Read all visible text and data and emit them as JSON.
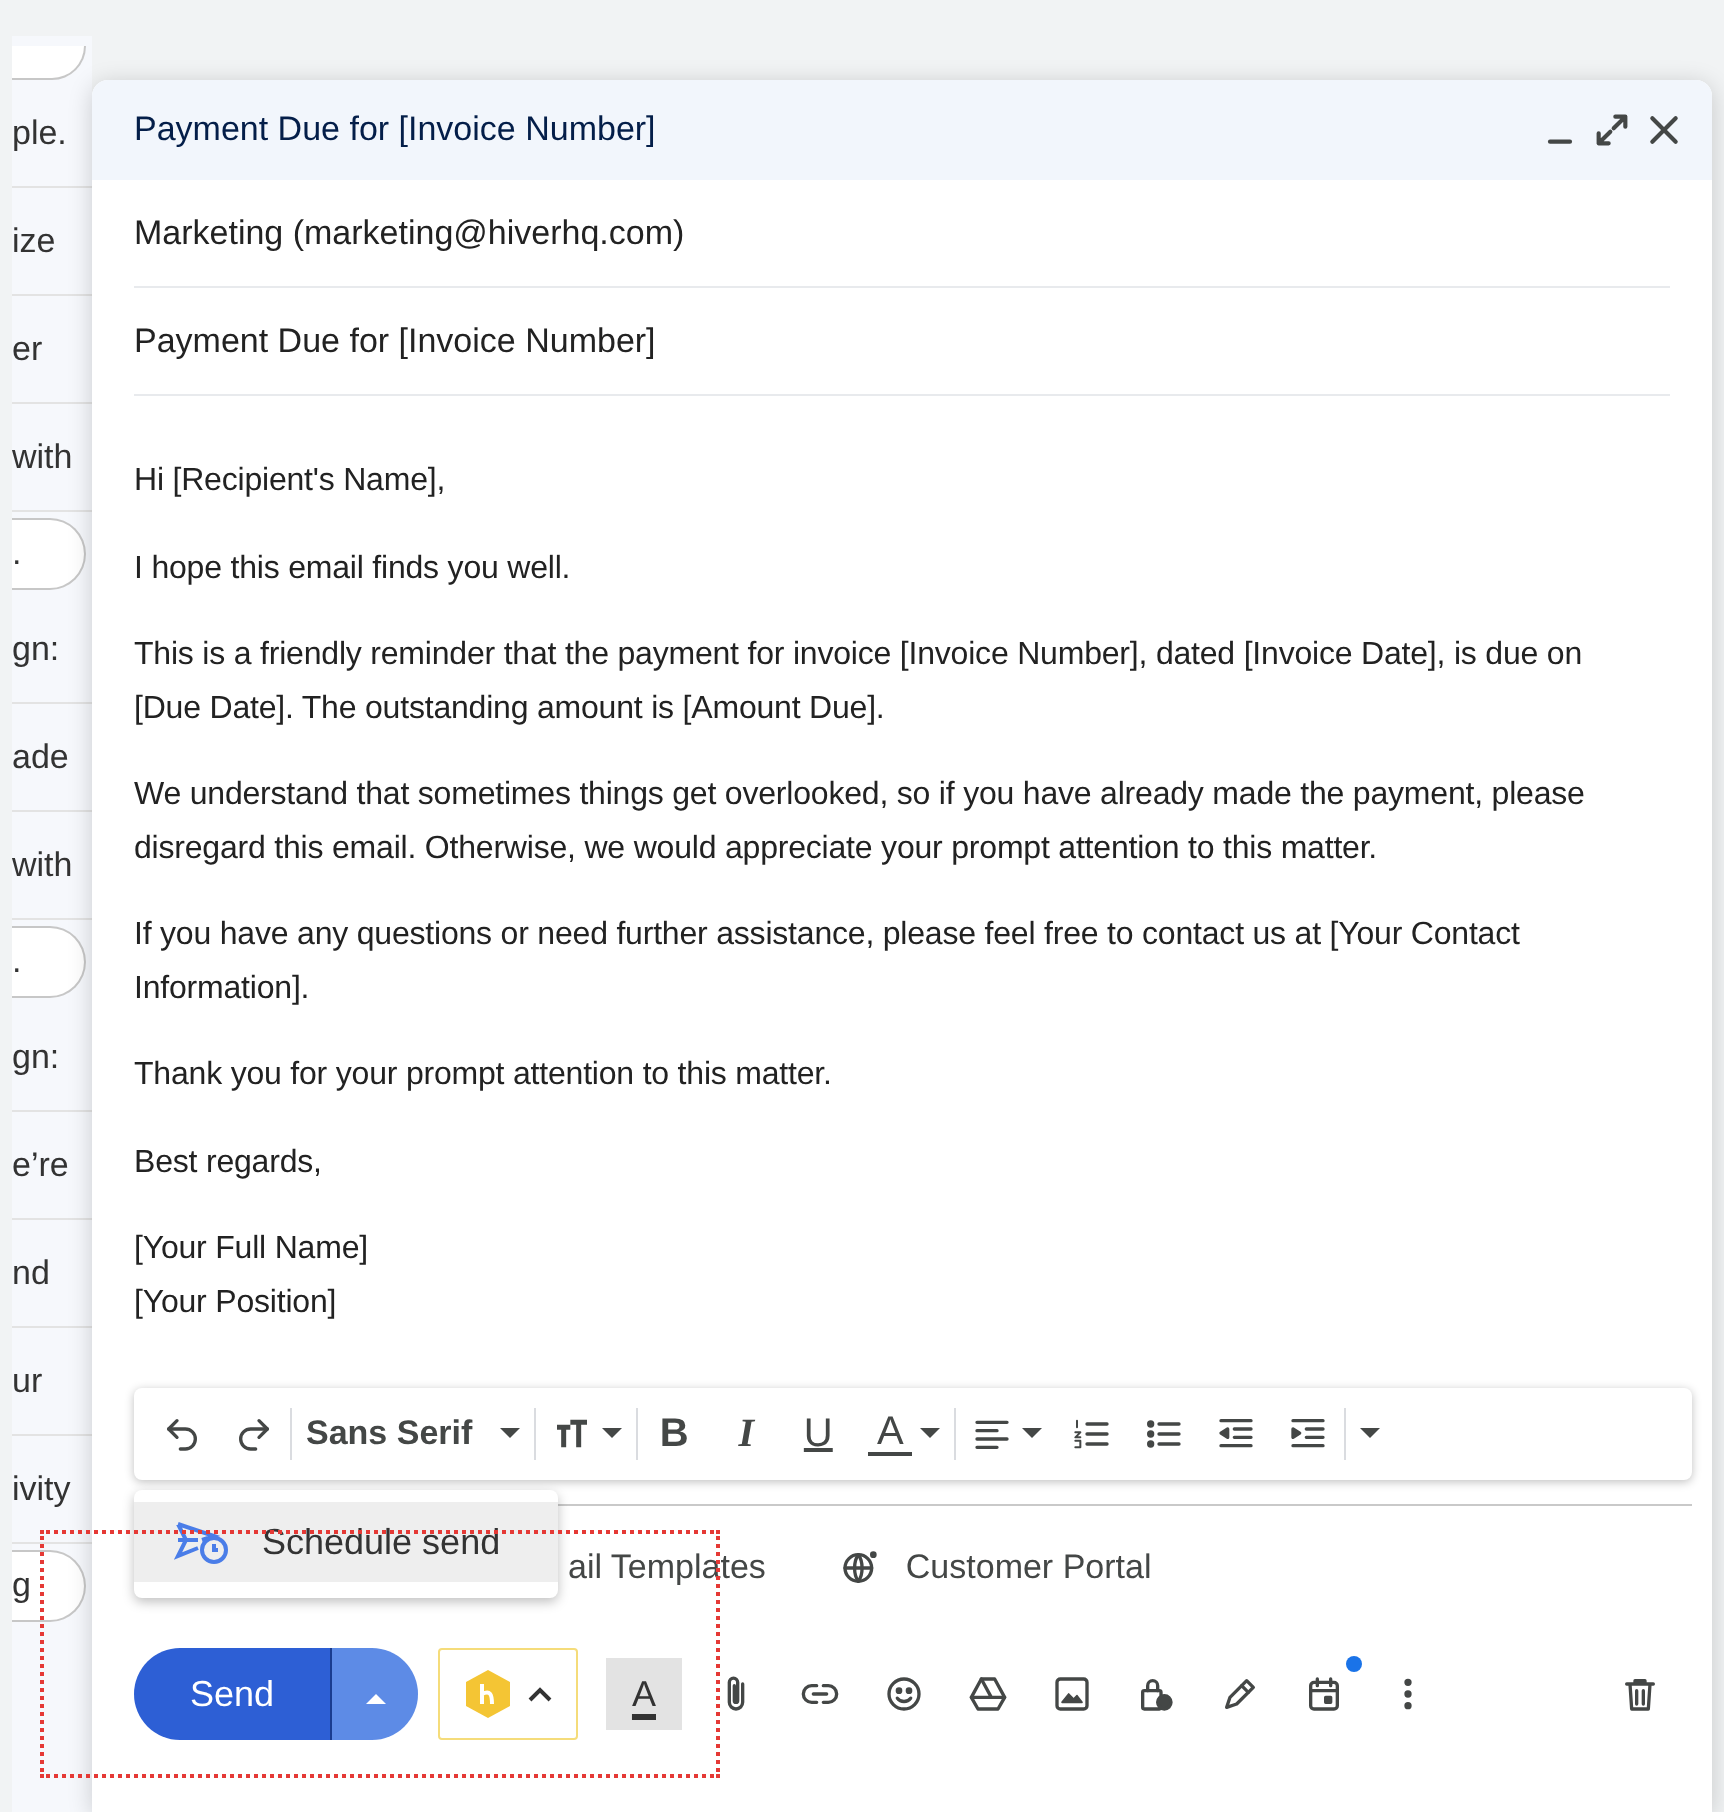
{
  "background_list": [
    {
      "kind": "pill"
    },
    {
      "kind": "text",
      "text": "ple."
    },
    {
      "kind": "text",
      "text": "ize"
    },
    {
      "kind": "text",
      "text": "er"
    },
    {
      "kind": "text",
      "text": "with"
    },
    {
      "kind": "pill",
      "text": "."
    },
    {
      "kind": "text",
      "text": "gn:"
    },
    {
      "kind": "text",
      "text": "ade"
    },
    {
      "kind": "text",
      "text": "with"
    },
    {
      "kind": "pill",
      "text": "."
    },
    {
      "kind": "text",
      "text": "gn:"
    },
    {
      "kind": "text",
      "text": "e’re"
    },
    {
      "kind": "text",
      "text": "nd"
    },
    {
      "kind": "text",
      "text": "ur"
    },
    {
      "kind": "text",
      "text": "ivity"
    },
    {
      "kind": "pill",
      "text": "g"
    }
  ],
  "compose": {
    "title": "Payment Due for [Invoice Number]",
    "window_controls": [
      {
        "kind": "minimize"
      },
      {
        "kind": "expand"
      },
      {
        "kind": "close"
      }
    ],
    "from": "Marketing (marketing@hiverhq.com)",
    "subject": "Payment Due for [Invoice Number]",
    "body": [
      "Hi [Recipient's Name],",
      "I hope this email finds you well.",
      "This is a friendly reminder that the payment for invoice [Invoice Number], dated [Invoice Date], is due on [Due Date]. The outstanding amount is [Amount Due].",
      "We understand that sometimes things get overlooked, so if you have already made the payment, please disregard this email. Otherwise, we would appreciate your prompt attention to this matter.",
      "If you have any questions or need further assistance, please feel free to contact us at [Your Contact Information].",
      "Thank you for your prompt attention to this matter.",
      "Best regards,",
      "[Your Full Name]\n[Your Position]"
    ],
    "format_toolbar": [
      {
        "kind": "undo"
      },
      {
        "kind": "redo"
      },
      {
        "kind": "sep"
      },
      {
        "kind": "font",
        "label": "Sans Serif"
      },
      {
        "kind": "sep"
      },
      {
        "kind": "size"
      },
      {
        "kind": "sep"
      },
      {
        "kind": "bold",
        "label": "B"
      },
      {
        "kind": "italic",
        "label": "I"
      },
      {
        "kind": "underline",
        "label": "U"
      },
      {
        "kind": "color",
        "label": "A"
      },
      {
        "kind": "sep"
      },
      {
        "kind": "align"
      },
      {
        "kind": "numbered"
      },
      {
        "kind": "bulleted"
      },
      {
        "kind": "outdent"
      },
      {
        "kind": "indent"
      },
      {
        "kind": "sep"
      },
      {
        "kind": "more"
      }
    ],
    "add_ons": [
      {
        "kind": "templates",
        "label": "ail Templates"
      },
      {
        "kind": "portal",
        "label": "Customer Portal"
      }
    ],
    "send_label": "Send",
    "send_menu": {
      "open": true,
      "items": [
        {
          "label": "Schedule send",
          "selected": true
        }
      ]
    },
    "bottom_tools": [
      {
        "kind": "hiver"
      },
      {
        "kind": "textcolor",
        "label": "A",
        "selected": true
      },
      {
        "kind": "attach"
      },
      {
        "kind": "link"
      },
      {
        "kind": "emoji"
      },
      {
        "kind": "drive"
      },
      {
        "kind": "photo"
      },
      {
        "kind": "lock"
      },
      {
        "kind": "pen"
      },
      {
        "kind": "calendar",
        "notification": true
      },
      {
        "kind": "dots"
      },
      {
        "kind": "trash"
      }
    ]
  },
  "annotation": {
    "kind": "dotted-frame"
  }
}
